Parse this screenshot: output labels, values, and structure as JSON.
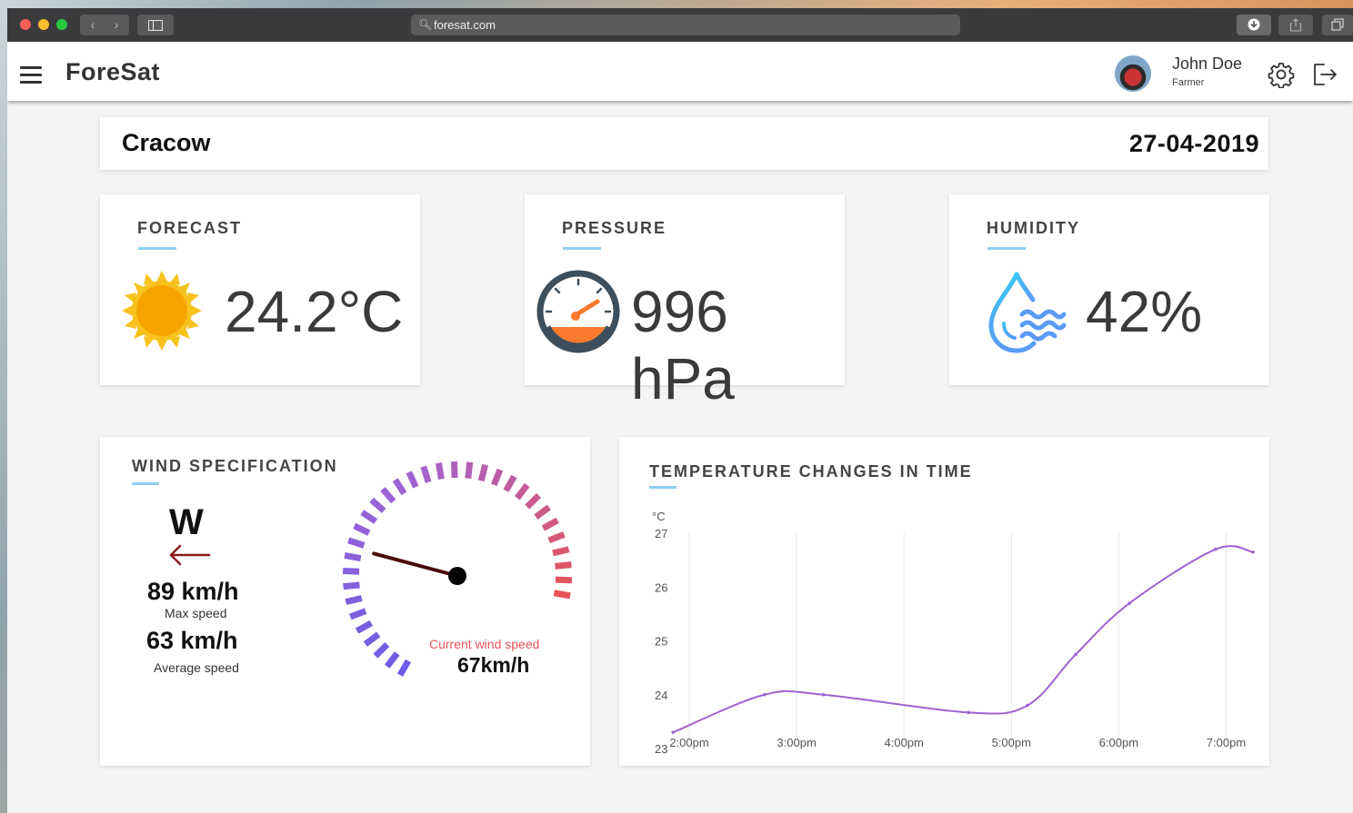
{
  "browser": {
    "url": "foresat.com",
    "back_icon": "chevron-left-icon",
    "forward_icon": "chevron-right-icon"
  },
  "app": {
    "logo": "ForeSat",
    "user": {
      "name": "John Doe",
      "role": "Farmer"
    }
  },
  "location": {
    "city": "Cracow",
    "date": "27-04-2019"
  },
  "cards": {
    "forecast": {
      "title": "FORECAST",
      "value": "24.2°C",
      "icon": "sun-icon"
    },
    "pressure": {
      "title": "PRESSURE",
      "value": "996 hPa",
      "icon": "gauge-icon"
    },
    "humidity": {
      "title": "HUMIDITY",
      "value": "42%",
      "icon": "water-drop-icon"
    }
  },
  "wind": {
    "title": "WIND SPECIFICATION",
    "direction": "W",
    "max_speed": "89 km/h",
    "max_label": "Max speed",
    "avg_speed": "63 km/h",
    "avg_label": "Average speed",
    "current_label": "Current wind speed",
    "current_value": "67km/h",
    "gauge_fraction": 0.3
  },
  "temperature": {
    "title": "TEMPERATURE CHANGES IN TIME"
  },
  "chart_data": {
    "type": "line",
    "title": "TEMPERATURE CHANGES IN TIME",
    "ylabel": "°C",
    "xlabel": "",
    "x_ticks": [
      "2:00pm",
      "3:00pm",
      "4:00pm",
      "5:00pm",
      "6:00pm",
      "7:00pm"
    ],
    "y_ticks": [
      23,
      24,
      25,
      26,
      27
    ],
    "ylim": [
      23,
      27
    ],
    "xlim": [
      14.0,
      19.25
    ],
    "grid": "vertical",
    "series": [
      {
        "color": "#a062cf",
        "x": [
          13.85,
          14.7,
          15.25,
          16.6,
          17.15,
          17.6,
          18.1,
          18.9,
          19.25
        ],
        "y": [
          23.3,
          24.0,
          24.0,
          23.67,
          23.8,
          24.75,
          25.7,
          26.7,
          26.65
        ]
      }
    ]
  }
}
